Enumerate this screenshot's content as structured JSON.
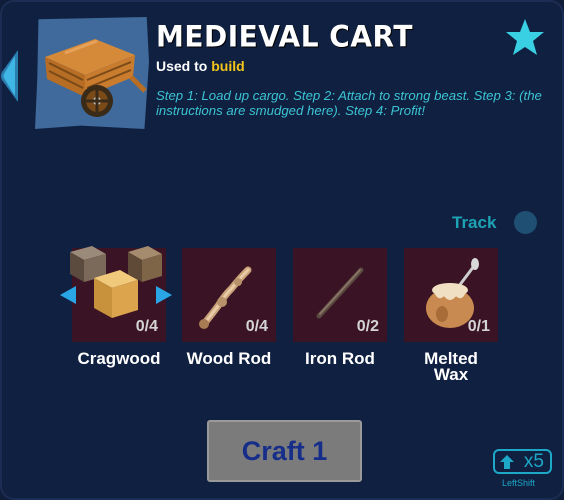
{
  "item": {
    "title": "MEDIEVAL CART",
    "used_prefix": "Used to ",
    "used_highlight": "build",
    "description": "Step 1: Load up cargo. Step 2: Attach to strong beast. Step 3: (the instructions are smudged here). Step 4: Profit!",
    "image_icon": "wooden-cart-icon"
  },
  "favorite_icon": "star-icon",
  "track": {
    "label": "Track",
    "enabled": false
  },
  "ingredients": [
    {
      "name": "Cragwood",
      "count": "0/4",
      "icon": "wood-blocks-icon",
      "has_variants": true
    },
    {
      "name": "Wood Rod",
      "count": "0/4",
      "icon": "wood-rod-icon"
    },
    {
      "name": "Iron Rod",
      "count": "0/2",
      "icon": "iron-rod-icon"
    },
    {
      "name": "Melted Wax",
      "name_line1": "Melted",
      "name_line2": "Wax",
      "count": "0/1",
      "icon": "wax-pot-icon"
    }
  ],
  "craft": {
    "label": "Craft 1"
  },
  "multiplier": {
    "label": "x5",
    "key_hint": "LeftShift",
    "icon": "shift-key-icon"
  },
  "colors": {
    "background": "#102041",
    "accent": "#3cc4d3",
    "highlight": "#f2c51b",
    "slot": "#3a1424",
    "craft_text": "#162e8a"
  }
}
